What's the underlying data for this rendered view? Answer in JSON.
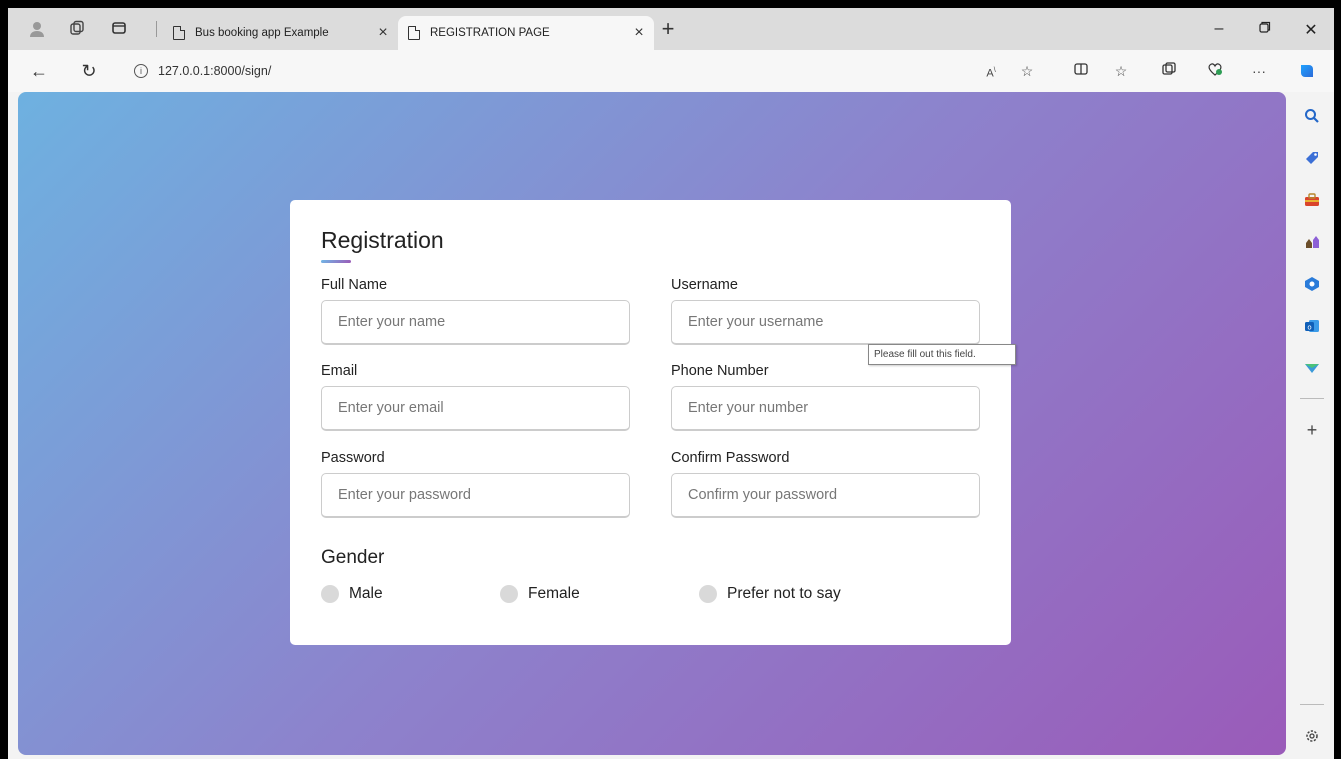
{
  "browser": {
    "tabs": [
      {
        "title": "Bus booking app Example",
        "active": false
      },
      {
        "title": "REGISTRATION PAGE",
        "active": true
      }
    ],
    "url": "127.0.0.1:8000/sign/",
    "new_tab_glyph": "+",
    "close_glyph": "×"
  },
  "form": {
    "title": "Registration",
    "fields": {
      "full_name": {
        "label": "Full Name",
        "placeholder": "Enter your name"
      },
      "username": {
        "label": "Username",
        "placeholder": "Enter your username"
      },
      "email": {
        "label": "Email",
        "placeholder": "Enter your email"
      },
      "phone": {
        "label": "Phone Number",
        "placeholder": "Enter your number"
      },
      "password": {
        "label": "Password",
        "placeholder": "Enter your password"
      },
      "confirm_password": {
        "label": "Confirm Password",
        "placeholder": "Confirm your password"
      }
    },
    "gender": {
      "title": "Gender",
      "options": [
        "Male",
        "Female",
        "Prefer not to say"
      ]
    },
    "validation_tooltip": "Please fill out this field."
  },
  "colors": {
    "gradient_start": "#6eb1e0",
    "gradient_end": "#9a5bb9"
  }
}
